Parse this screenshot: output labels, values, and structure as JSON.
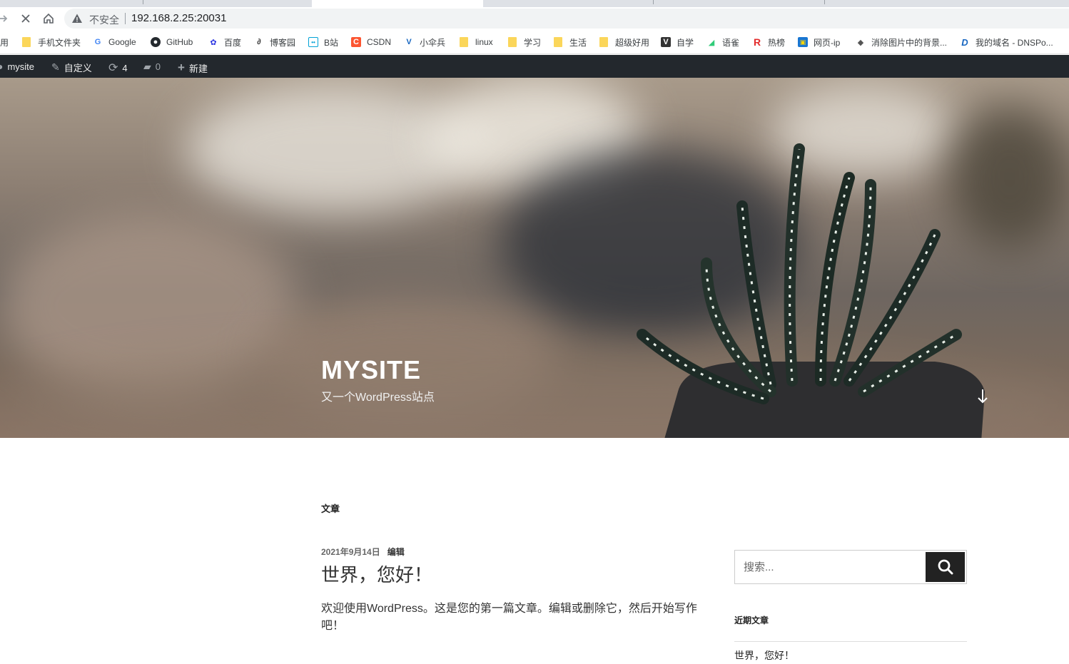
{
  "browser": {
    "insecure_label": "不安全",
    "url": "192.168.2.25:20031"
  },
  "bookmarks": [
    {
      "label": "用",
      "icon": "none"
    },
    {
      "label": "手机文件夹",
      "icon": "folder-icon"
    },
    {
      "label": "Google",
      "icon": "google-icon"
    },
    {
      "label": "GitHub",
      "icon": "github-icon"
    },
    {
      "label": "百度",
      "icon": "baidu-icon"
    },
    {
      "label": "博客园",
      "icon": "cnblogs-icon"
    },
    {
      "label": "B站",
      "icon": "bilibili-icon"
    },
    {
      "label": "CSDN",
      "icon": "csdn-icon"
    },
    {
      "label": "小伞兵",
      "icon": "v-icon"
    },
    {
      "label": "linux",
      "icon": "folder-icon"
    },
    {
      "label": "学习",
      "icon": "folder-icon"
    },
    {
      "label": "生活",
      "icon": "folder-icon"
    },
    {
      "label": "超级好用",
      "icon": "folder-icon"
    },
    {
      "label": "自学",
      "icon": "v-icon"
    },
    {
      "label": "语雀",
      "icon": "yuque-icon"
    },
    {
      "label": "热榜",
      "icon": "r-icon"
    },
    {
      "label": "网页-ip",
      "icon": "ip-icon"
    },
    {
      "label": "消除图片中的背景...",
      "icon": "layers-icon"
    },
    {
      "label": "我的域名 - DNSPo...",
      "icon": "dnspod-icon"
    }
  ],
  "adminbar": {
    "site": "mysite",
    "customize": "自定义",
    "updates": "4",
    "comments": "0",
    "new": "新建"
  },
  "hero": {
    "title": "MYSITE",
    "description": "又一个WordPress站点"
  },
  "content": {
    "section_title": "文章",
    "post": {
      "date": "2021年9月14日",
      "edit": "编辑",
      "title": "世界，您好！",
      "excerpt": "欢迎使用WordPress。这是您的第一篇文章。编辑或删除它，然后开始写作吧！"
    }
  },
  "sidebar": {
    "search_placeholder": "搜索...",
    "recent_title": "近期文章",
    "recent_posts": [
      "世界，您好！"
    ]
  },
  "colors": {
    "admin_bar": "#23282d",
    "search_button": "#222222",
    "folder": "#fbd65a"
  }
}
